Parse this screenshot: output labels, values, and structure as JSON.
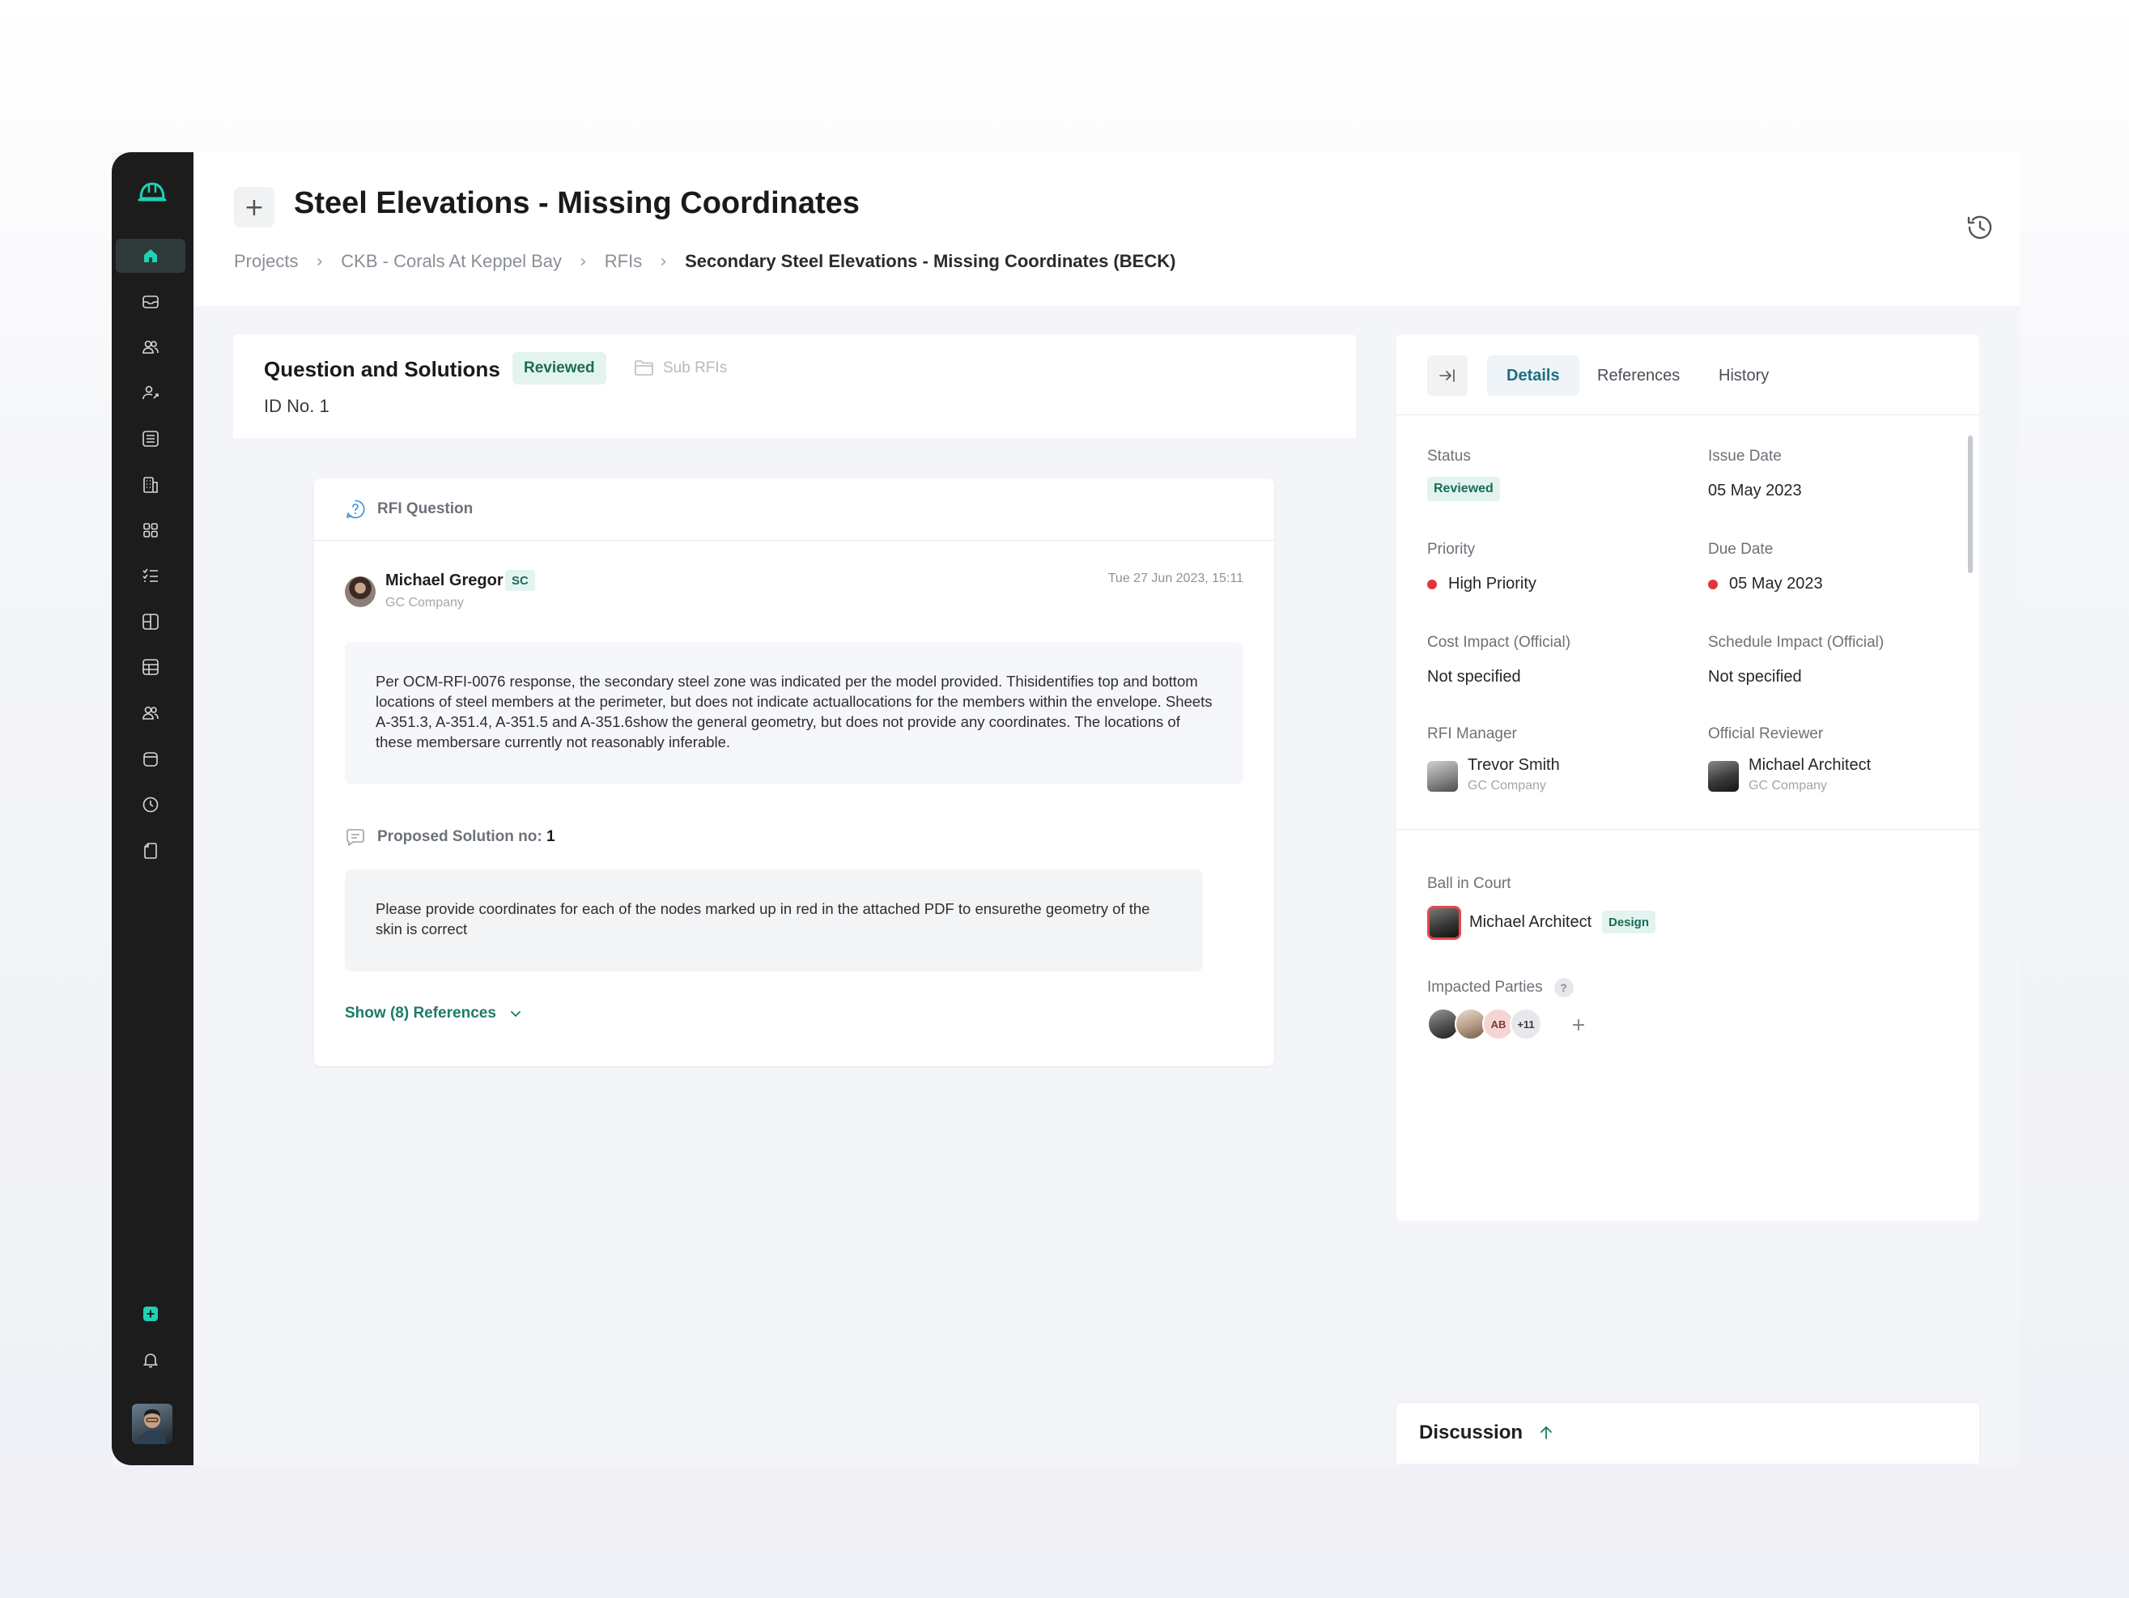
{
  "header": {
    "title": "Steel Elevations - Missing Coordinates",
    "breadcrumb": [
      "Projects",
      "CKB - Corals At Keppel Bay",
      "RFIs",
      "Secondary Steel Elevations - Missing Coordinates (BECK)"
    ],
    "plus_glyph": "+",
    "sep_glyph": "›"
  },
  "sidebar": {
    "items": [
      "home-icon",
      "inbox-icon",
      "team-icon",
      "user-share-icon",
      "list-icon",
      "building-icon",
      "grid-icon",
      "checklist-icon",
      "layout-icon",
      "table-icon",
      "group-icon",
      "calendar-icon",
      "clock-icon",
      "document-icon"
    ],
    "bottom": [
      "add-square-icon",
      "bell-icon"
    ],
    "accent": "#1fd1b7"
  },
  "left_panel": {
    "title": "Question and Solutions",
    "status": "Reviewed",
    "sub_rfis": "Sub RFIs",
    "id_label": "ID No. 1",
    "rfi_card": {
      "heading": "RFI Question",
      "author": "Michael Gregor",
      "author_badge": "SC",
      "author_company": "GC Company",
      "timestamp": "Tue 27 Jun 2023, 15:11",
      "question": "Per OCM-RFI-0076 response, the secondary steel zone was indicated per the model provided. Thisidentifies top and bottom locations of steel members at the perimeter, but does not indicate actuallocations for the members within the envelope. Sheets A-351.3, A-351.4, A-351.5 and A-351.6show the general geometry, but does not provide any coordinates. The locations of these membersare currently not reasonably inferable.",
      "proposed_label": "Proposed Solution no:",
      "proposed_num": "1",
      "solution": "Please provide coordinates for each of the nodes marked up in red in the attached PDF to ensurethe geometry of the skin is correct",
      "show_refs": "Show (8) References"
    }
  },
  "right_panel": {
    "tabs": [
      "Details",
      "References",
      "History"
    ],
    "active_tab": "Details",
    "status_label": "Status",
    "status_value": "Reviewed",
    "issue_date_label": "Issue Date",
    "issue_date": "05 May 2023",
    "priority_label": "Priority",
    "priority": "High Priority",
    "due_date_label": "Due Date",
    "due_date": "05 May 2023",
    "cost_label": "Cost Impact (Official)",
    "cost_value": "Not specified",
    "schedule_label": "Schedule Impact (Official)",
    "schedule_value": "Not specified",
    "manager_label": "RFI Manager",
    "manager_name": "Trevor Smith",
    "manager_company": "GC Company",
    "reviewer_label": "Official Reviewer",
    "reviewer_name": "Michael Architect",
    "reviewer_company": "GC Company",
    "ball_label": "Ball in Court",
    "ball_name": "Michael Architect",
    "ball_badge": "Design",
    "impacted_label": "Impacted Parties",
    "impacted_help": "?",
    "impacted_initials": "AB",
    "impacted_more": "+11",
    "add_glyph": "+",
    "priority_color": "#e0363b"
  },
  "discussion": {
    "title": "Discussion"
  }
}
